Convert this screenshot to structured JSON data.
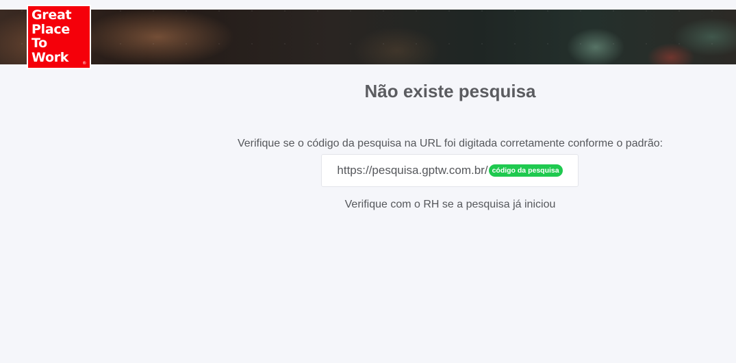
{
  "logo": {
    "lines": [
      "Great",
      "Place",
      "To",
      "Work"
    ],
    "registered": "®",
    "color": "#f5000a"
  },
  "main": {
    "title": "Não existe pesquisa",
    "instruction": "Verifique se o código da pesquisa na URL foi digitada corretamente conforme o padrão:",
    "url_prefix": "https://pesquisa.gptw.com.br/",
    "url_badge": "código da pesquisa",
    "hint": "Verifique com o RH se a pesquisa já iniciou"
  },
  "colors": {
    "background": "#f5f6fa",
    "badge": "#1fc94f",
    "text": "#55575b"
  }
}
